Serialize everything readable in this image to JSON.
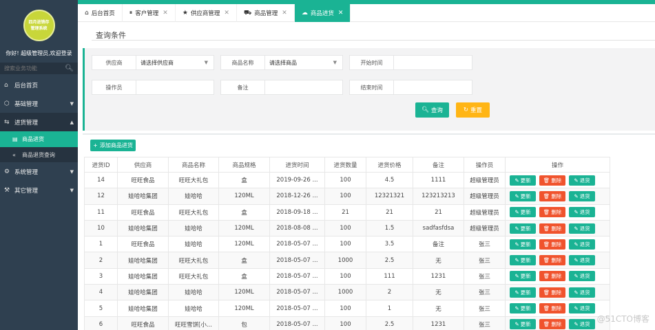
{
  "sidebar": {
    "logo_text": "四月进销存管理系统",
    "welcome": "你好! 超级管理员,欢迎登录",
    "search_placeholder": "搜索业务功能",
    "items": [
      {
        "label": "后台首页",
        "icon": "home-icon"
      },
      {
        "label": "基础管理",
        "icon": "cube-icon"
      },
      {
        "label": "进货管理",
        "icon": "truck-icon"
      },
      {
        "label": "系统管理",
        "icon": "gear-icon"
      },
      {
        "label": "其它管理",
        "icon": "sliders-icon"
      }
    ],
    "sub_items": [
      {
        "label": "商品进货"
      },
      {
        "label": "商品退货查询"
      }
    ]
  },
  "tabs": [
    {
      "label": "后台首页",
      "icon": "home-icon"
    },
    {
      "label": "客户管理",
      "icon": "pause-circle-icon"
    },
    {
      "label": "供应商管理",
      "icon": "star-icon"
    },
    {
      "label": "商品管理",
      "icon": "cart-icon"
    },
    {
      "label": "商品进货",
      "icon": "cloud-icon"
    }
  ],
  "query": {
    "title": "查询条件",
    "supplier_label": "供应商",
    "supplier_value": "请选择供应商",
    "goods_label": "商品名称",
    "goods_value": "请选择商品",
    "start_label": "开始时间",
    "start_value": "",
    "operator_label": "操作员",
    "operator_value": "",
    "remark_label": "备注",
    "remark_value": "",
    "end_label": "结束时间",
    "end_value": "",
    "search_button": "查询",
    "reset_button": "重置"
  },
  "add_button": "添加商品进货",
  "table": {
    "headers": [
      "进货ID",
      "供应商",
      "商品名称",
      "商品规格",
      "进货时间",
      "进货数量",
      "进货价格",
      "备注",
      "操作员",
      "操作"
    ],
    "buttons": {
      "update": "更新",
      "delete": "删除",
      "return": "退货"
    },
    "rows": [
      [
        "14",
        "旺旺食品",
        "旺旺大礼包",
        "盒",
        "2019-09-26 ...",
        "100",
        "4.5",
        "1111",
        "超级管理员"
      ],
      [
        "12",
        "娃哈哈集团",
        "娃哈哈",
        "120ML",
        "2018-12-26 ...",
        "100",
        "12321321",
        "123213213",
        "超级管理员"
      ],
      [
        "11",
        "旺旺食品",
        "旺旺大礼包",
        "盒",
        "2018-09-18 ...",
        "21",
        "21",
        "21",
        "超级管理员"
      ],
      [
        "10",
        "娃哈哈集团",
        "娃哈哈",
        "120ML",
        "2018-08-08 ...",
        "100",
        "1.5",
        "sadfasfdsa",
        "超级管理员"
      ],
      [
        "1",
        "旺旺食品",
        "娃哈哈",
        "120ML",
        "2018-05-07 ...",
        "100",
        "3.5",
        "备注",
        "张三"
      ],
      [
        "2",
        "娃哈哈集团",
        "旺旺大礼包",
        "盒",
        "2018-05-07 ...",
        "1000",
        "2.5",
        "无",
        "张三"
      ],
      [
        "3",
        "娃哈哈集团",
        "旺旺大礼包",
        "盒",
        "2018-05-07 ...",
        "100",
        "111",
        "1231",
        "张三"
      ],
      [
        "4",
        "娃哈哈集团",
        "娃哈哈",
        "120ML",
        "2018-05-07 ...",
        "1000",
        "2",
        "无",
        "张三"
      ],
      [
        "5",
        "娃哈哈集团",
        "娃哈哈",
        "120ML",
        "2018-05-07 ...",
        "100",
        "1",
        "无",
        "张三"
      ],
      [
        "6",
        "旺旺食品",
        "旺旺雪饼[小...",
        "包",
        "2018-05-07 ...",
        "100",
        "2.5",
        "1231",
        "张三"
      ]
    ]
  },
  "watermark": "@51CTO博客",
  "colors": {
    "accent": "#1ab394",
    "sidebar": "#2f4050",
    "delete": "#f0532d",
    "reset": "#ffb515"
  }
}
